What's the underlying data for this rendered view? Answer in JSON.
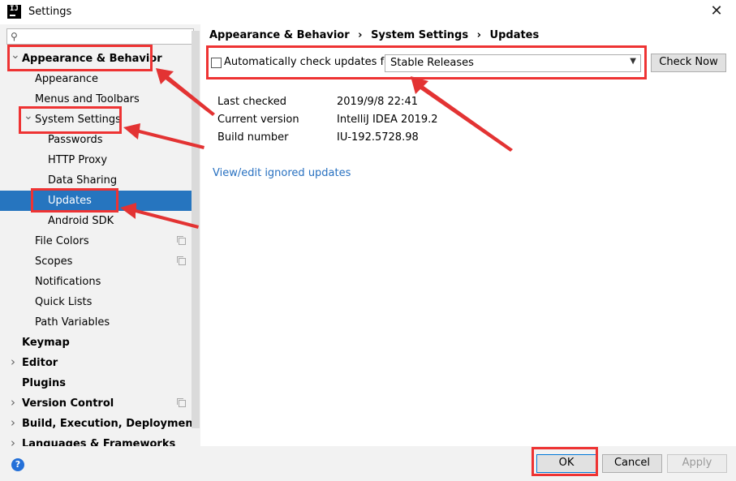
{
  "window": {
    "title": "Settings",
    "app_icon_text": "IJ",
    "close_glyph": "✕"
  },
  "search": {
    "placeholder": ""
  },
  "tree": [
    {
      "label": "Appearance & Behavior",
      "expanded": true,
      "bold": true
    },
    {
      "label": "Appearance"
    },
    {
      "label": "Menus and Toolbars"
    },
    {
      "label": "System Settings",
      "expanded": true
    },
    {
      "label": "Passwords"
    },
    {
      "label": "HTTP Proxy"
    },
    {
      "label": "Data Sharing"
    },
    {
      "label": "Updates",
      "selected": true
    },
    {
      "label": "Android SDK"
    },
    {
      "label": "File Colors",
      "copy_icon": true
    },
    {
      "label": "Scopes",
      "copy_icon": true
    },
    {
      "label": "Notifications"
    },
    {
      "label": "Quick Lists"
    },
    {
      "label": "Path Variables"
    },
    {
      "label": "Keymap",
      "bold": true
    },
    {
      "label": "Editor",
      "bold": true,
      "collapsed": true
    },
    {
      "label": "Plugins",
      "bold": true
    },
    {
      "label": "Version Control",
      "bold": true,
      "collapsed": true,
      "copy_icon": true
    },
    {
      "label": "Build, Execution, Deployment",
      "bold": true,
      "collapsed": true
    },
    {
      "label": "Languages & Frameworks",
      "bold": true,
      "collapsed": true
    }
  ],
  "breadcrumb": [
    "Appearance & Behavior",
    "System Settings",
    "Updates"
  ],
  "breadcrumb_sep": "›",
  "updates": {
    "auto_check_label": "Automatically check updates for",
    "auto_check_checked": false,
    "channel": "Stable Releases",
    "check_now": "Check Now",
    "info": [
      {
        "key": "Last checked",
        "value": "2019/9/8 22:41"
      },
      {
        "key": "Current version",
        "value": "IntelliJ IDEA 2019.2"
      },
      {
        "key": "Build number",
        "value": "IU-192.5728.98"
      }
    ],
    "link": "View/edit ignored updates"
  },
  "buttons": {
    "ok": "OK",
    "cancel": "Cancel",
    "apply": "Apply"
  },
  "help_glyph": "?",
  "colors": {
    "selection": "#2675bf",
    "annotation": "#e33333",
    "link": "#2770c0"
  }
}
